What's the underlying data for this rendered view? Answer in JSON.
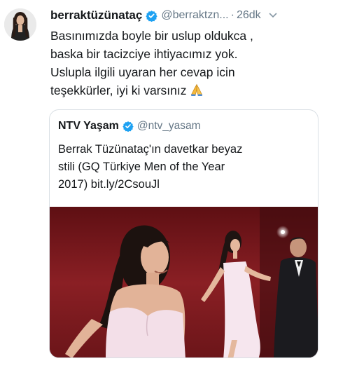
{
  "tweet": {
    "author": {
      "display_name": "berraktüzünataç",
      "handle": "@berraktzn...",
      "separator": "·",
      "time": "26dk"
    },
    "body_lines": [
      "Basınımızda boyle bir uslup oldukca ,",
      "baska bir tacizciye ihtiyacımız yok.",
      "Uslupla ilgili uyaran her cevap icin",
      "teşekkürler, iyi ki varsınız"
    ],
    "quoted": {
      "display_name": "NTV Yaşam",
      "handle": "@ntv_yasam",
      "text_lines": [
        "Berrak Tüzünataç'ın davetkar beyaz",
        "stili (GQ Türkiye Men of the Year",
        "2017) bit.ly/2CsouJl"
      ]
    }
  },
  "colors": {
    "text": "#14171a",
    "secondary": "#657786",
    "verified": "#1da1f2",
    "card_border": "#d9dfe4",
    "carpet": "#7a1a1e"
  },
  "icons": {
    "verified": "verified-badge-icon",
    "caret": "chevron-down-icon",
    "emoji": "folded-hands-emoji"
  }
}
